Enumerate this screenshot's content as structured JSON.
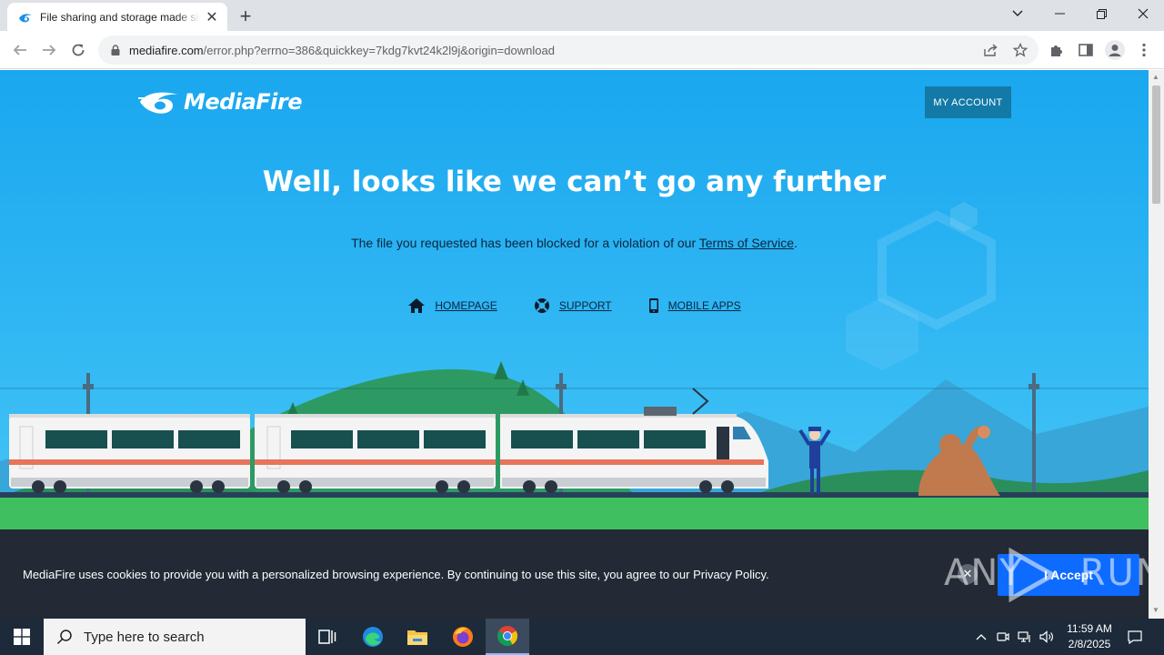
{
  "browser": {
    "tab_title": "File sharing and storage made simple",
    "url_host": "mediafire.com",
    "url_path": "/error.php?errno=386&quickkey=7kdg7kvt24k2l9j&origin=download"
  },
  "page": {
    "logo_text": "MediaFire",
    "my_account_label": "MY ACCOUNT",
    "headline": "Well, looks like we can’t go any further",
    "sub_before": "The file you requested has been blocked for a violation of our ",
    "tos_link": "Terms of Service",
    "sub_after": ".",
    "links": {
      "homepage": "HOMEPAGE",
      "support": "SUPPORT",
      "mobile_apps": "MOBILE APPS"
    }
  },
  "cookie": {
    "text": "MediaFire uses cookies to provide you with a personalized browsing experience. By continuing to use this site, you agree to our Privacy Policy.",
    "accept_label": "I Accept",
    "close_symbol": "✕"
  },
  "watermark": {
    "left": "ANY",
    "right": "RUN"
  },
  "taskbar": {
    "search_placeholder": "Type here to search",
    "time": "11:59 AM",
    "date": "2/8/2025"
  },
  "colors": {
    "sky": "#1aa7ef",
    "grass": "#3fbf5f",
    "cookie_bg": "#232a36",
    "accept_btn": "#0d6bff",
    "account_btn": "#137aa8"
  }
}
